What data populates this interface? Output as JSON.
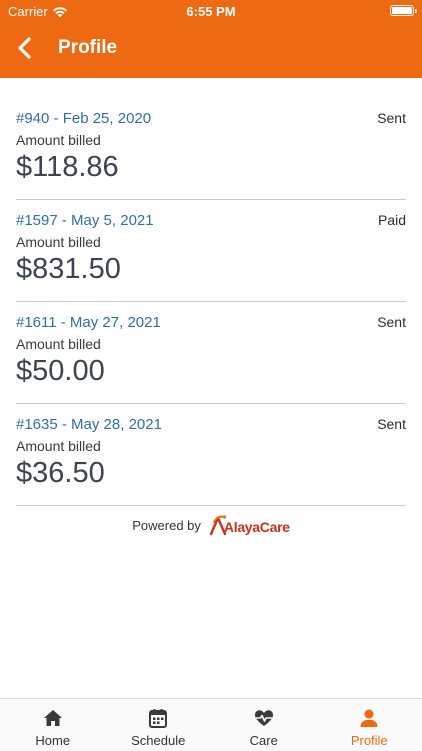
{
  "status_bar": {
    "carrier": "Carrier",
    "time": "6:55 PM"
  },
  "header": {
    "title": "Profile",
    "background_color": "#ee6a12"
  },
  "invoices": [
    {
      "title": "#940 - Feb 25, 2020",
      "status": "Sent",
      "label": "Amount billed",
      "amount": "$118.86"
    },
    {
      "title": "#1597 - May 5, 2021",
      "status": "Paid",
      "label": "Amount billed",
      "amount": "$831.50"
    },
    {
      "title": "#1611 - May 27, 2021",
      "status": "Sent",
      "label": "Amount billed",
      "amount": "$50.00"
    },
    {
      "title": "#1635 - May 28, 2021",
      "status": "Sent",
      "label": "Amount billed",
      "amount": "$36.50"
    }
  ],
  "footer": {
    "powered_by": "Powered by",
    "brand": "AlayaCare"
  },
  "tabs": [
    {
      "label": "Home",
      "icon": "home-icon"
    },
    {
      "label": "Schedule",
      "icon": "calendar-icon"
    },
    {
      "label": "Care",
      "icon": "heart-pulse-icon"
    },
    {
      "label": "Profile",
      "icon": "person-icon",
      "active": true
    }
  ],
  "colors": {
    "accent": "#ee6a12",
    "link": "#2f6fa4",
    "amount": "#3c4450"
  }
}
